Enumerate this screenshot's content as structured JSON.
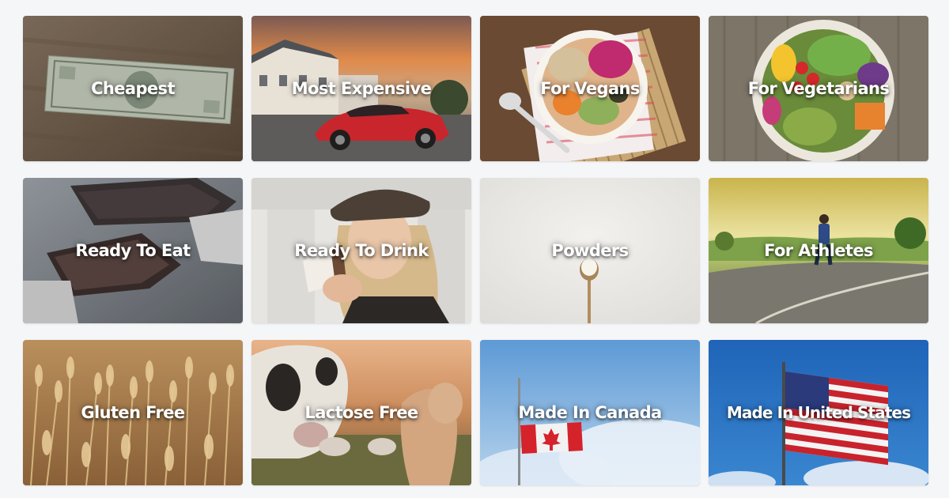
{
  "categories": [
    {
      "label": "Cheapest"
    },
    {
      "label": "Most Expensive"
    },
    {
      "label": "For Vegans"
    },
    {
      "label": "For Vegetarians"
    },
    {
      "label": "Ready To Eat"
    },
    {
      "label": "Ready To Drink"
    },
    {
      "label": "Powders"
    },
    {
      "label": "For Athletes"
    },
    {
      "label": "Gluten Free"
    },
    {
      "label": "Lactose Free"
    },
    {
      "label": "Made In Canada"
    },
    {
      "label": "Made In United States"
    }
  ],
  "colors": {
    "page_background": "#f5f6f8",
    "label_text": "#ffffff"
  }
}
